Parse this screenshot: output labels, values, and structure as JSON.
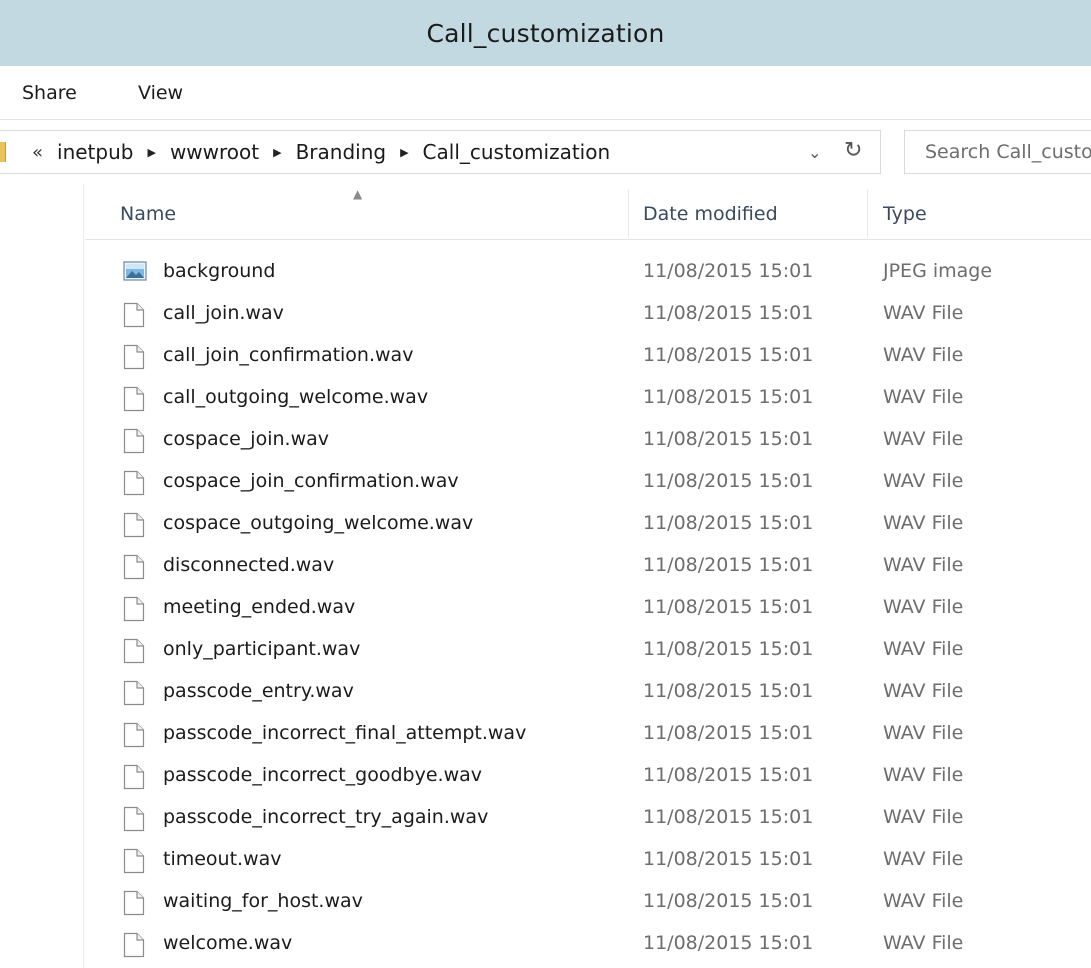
{
  "window": {
    "title": "Call_customization"
  },
  "ribbon": {
    "tabs": [
      "Share",
      "View"
    ]
  },
  "address": {
    "overflow_chevron": "«",
    "breadcrumbs": [
      "inetpub",
      "wwwroot",
      "Branding",
      "Call_customization"
    ],
    "dropdown_glyph": "⌄",
    "refresh_glyph": "↻"
  },
  "search": {
    "placeholder": "Search Call_customization"
  },
  "columns": {
    "name": "Name",
    "date": "Date modified",
    "type": "Type",
    "sort_indicator": "▲"
  },
  "files": [
    {
      "name": "background",
      "date": "11/08/2015 15:01",
      "type": "JPEG image",
      "icon": "image-file-icon"
    },
    {
      "name": "call_join.wav",
      "date": "11/08/2015 15:01",
      "type": "WAV File",
      "icon": "file-icon"
    },
    {
      "name": "call_join_confirmation.wav",
      "date": "11/08/2015 15:01",
      "type": "WAV File",
      "icon": "file-icon"
    },
    {
      "name": "call_outgoing_welcome.wav",
      "date": "11/08/2015 15:01",
      "type": "WAV File",
      "icon": "file-icon"
    },
    {
      "name": "cospace_join.wav",
      "date": "11/08/2015 15:01",
      "type": "WAV File",
      "icon": "file-icon"
    },
    {
      "name": "cospace_join_confirmation.wav",
      "date": "11/08/2015 15:01",
      "type": "WAV File",
      "icon": "file-icon"
    },
    {
      "name": "cospace_outgoing_welcome.wav",
      "date": "11/08/2015 15:01",
      "type": "WAV File",
      "icon": "file-icon"
    },
    {
      "name": "disconnected.wav",
      "date": "11/08/2015 15:01",
      "type": "WAV File",
      "icon": "file-icon"
    },
    {
      "name": "meeting_ended.wav",
      "date": "11/08/2015 15:01",
      "type": "WAV File",
      "icon": "file-icon"
    },
    {
      "name": "only_participant.wav",
      "date": "11/08/2015 15:01",
      "type": "WAV File",
      "icon": "file-icon"
    },
    {
      "name": "passcode_entry.wav",
      "date": "11/08/2015 15:01",
      "type": "WAV File",
      "icon": "file-icon"
    },
    {
      "name": "passcode_incorrect_final_attempt.wav",
      "date": "11/08/2015 15:01",
      "type": "WAV File",
      "icon": "file-icon"
    },
    {
      "name": "passcode_incorrect_goodbye.wav",
      "date": "11/08/2015 15:01",
      "type": "WAV File",
      "icon": "file-icon"
    },
    {
      "name": "passcode_incorrect_try_again.wav",
      "date": "11/08/2015 15:01",
      "type": "WAV File",
      "icon": "file-icon"
    },
    {
      "name": "timeout.wav",
      "date": "11/08/2015 15:01",
      "type": "WAV File",
      "icon": "file-icon"
    },
    {
      "name": "waiting_for_host.wav",
      "date": "11/08/2015 15:01",
      "type": "WAV File",
      "icon": "file-icon"
    },
    {
      "name": "welcome.wav",
      "date": "11/08/2015 15:01",
      "type": "WAV File",
      "icon": "file-icon"
    }
  ],
  "colors": {
    "titlebar": "#c3d9e1",
    "header_text": "#3a4a5f",
    "secondary_text": "#6d6d6d"
  }
}
